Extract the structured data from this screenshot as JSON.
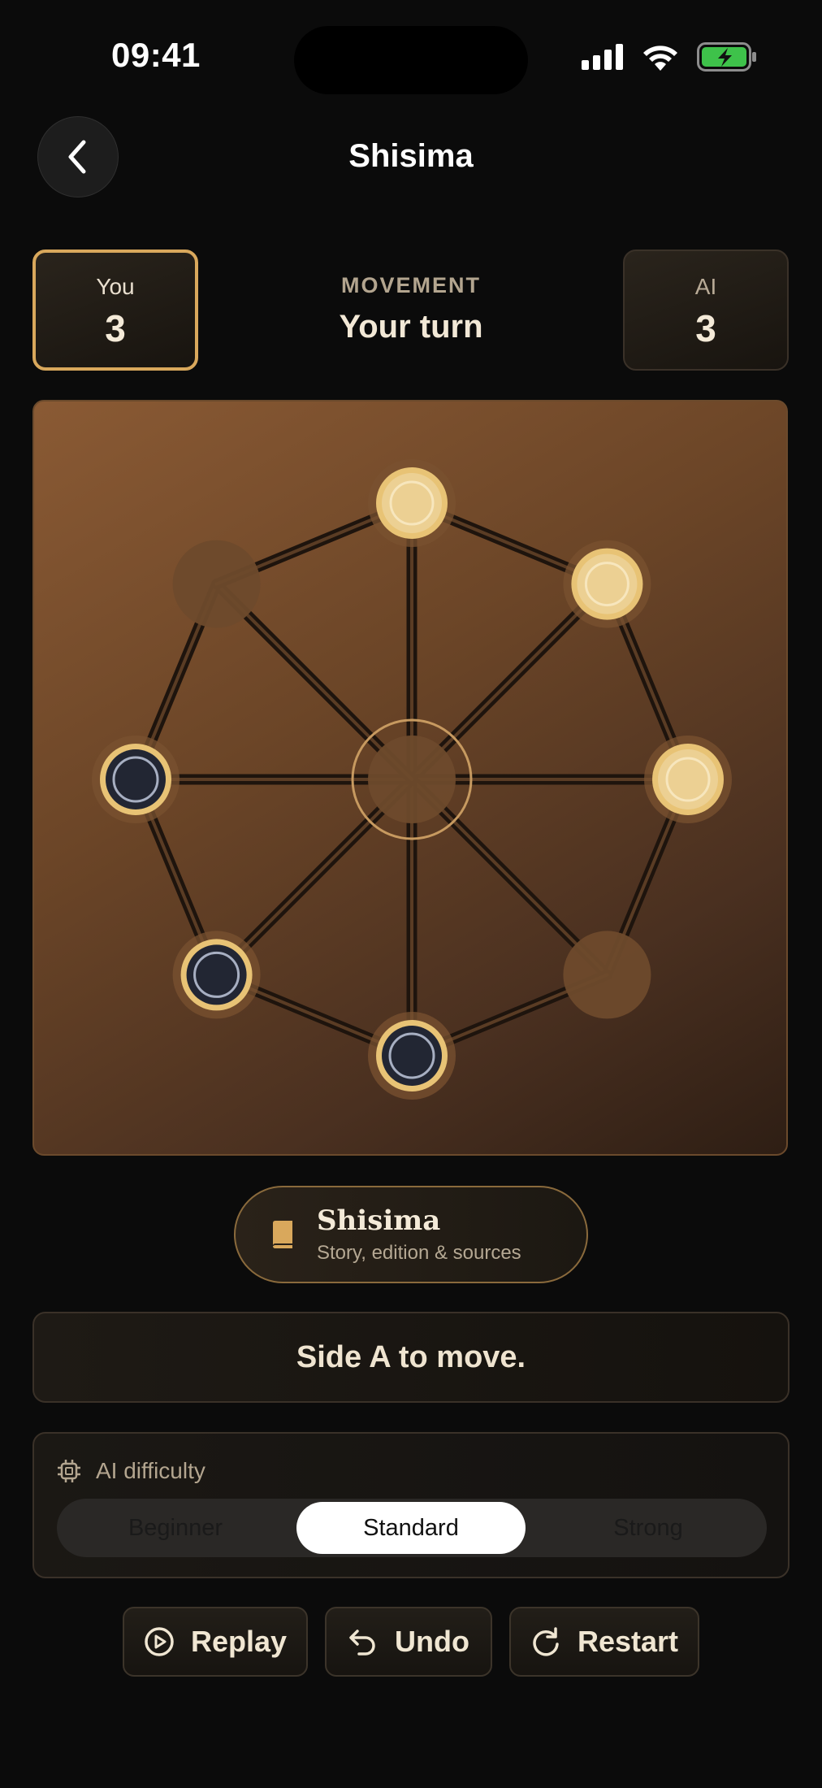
{
  "status_bar": {
    "time": "09:41",
    "battery_color": "#3ec24a"
  },
  "header": {
    "title": "Shisima",
    "back_icon": "chevron-left-icon"
  },
  "scores": {
    "you": {
      "label": "You",
      "score": "3"
    },
    "ai": {
      "label": "AI",
      "score": "3"
    }
  },
  "phase": {
    "label": "MOVEMENT",
    "turn": "Your turn"
  },
  "board": {
    "center_piece": "empty",
    "outer_points": [
      {
        "position": "top",
        "piece": "light"
      },
      {
        "position": "top-right",
        "piece": "light"
      },
      {
        "position": "right",
        "piece": "light"
      },
      {
        "position": "bottom-right",
        "piece": "empty"
      },
      {
        "position": "bottom",
        "piece": "dark"
      },
      {
        "position": "bottom-left",
        "piece": "dark"
      },
      {
        "position": "left",
        "piece": "dark"
      },
      {
        "position": "top-left",
        "piece": "empty"
      }
    ],
    "colors": {
      "light_piece": "#ecd093",
      "dark_piece": "#222633",
      "ring": "#e8c375",
      "empty_point": "#6e4a2c"
    }
  },
  "story": {
    "title": "Shisima",
    "subtitle": "Story, edition & sources",
    "icon": "book-icon"
  },
  "message": "Side A to move.",
  "difficulty": {
    "label": "AI difficulty",
    "icon": "cpu-chip-icon",
    "options": [
      "Beginner",
      "Standard",
      "Strong"
    ],
    "selected": "Standard"
  },
  "actions": {
    "replay": {
      "label": "Replay",
      "icon": "play-circle-icon"
    },
    "undo": {
      "label": "Undo",
      "icon": "undo-arrow-icon"
    },
    "restart": {
      "label": "Restart",
      "icon": "restart-icon"
    }
  },
  "accent_color": "#d9a85c"
}
